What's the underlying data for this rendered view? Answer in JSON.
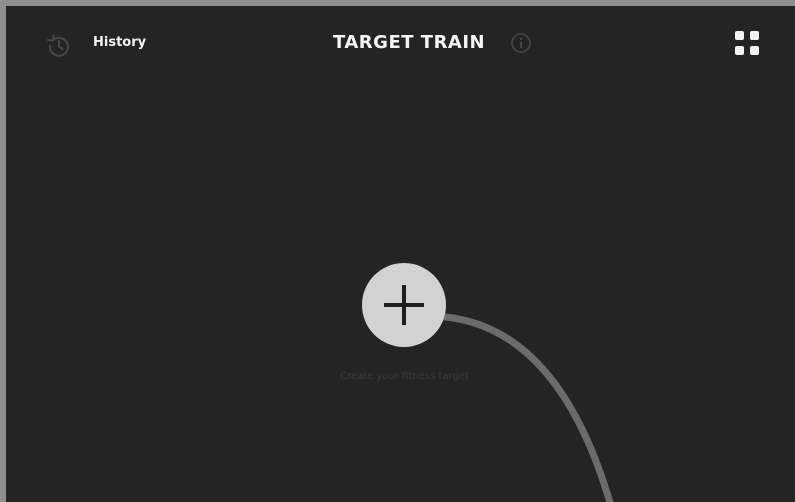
{
  "header": {
    "history_label": "History",
    "title": "TARGET TRAIN",
    "icons": {
      "history": "history-icon",
      "info": "info-icon",
      "menu": "grid-menu-icon"
    }
  },
  "main": {
    "add_button_icon": "plus-icon",
    "create_target_text": "Create your fitness target"
  },
  "colors": {
    "background": "#242424",
    "frame": "#8e8e8e",
    "add_button": "#d2d2d2",
    "header_text": "#f2f2f2",
    "muted_icon": "#4a4a4a",
    "arc": "#6b6b6b"
  }
}
